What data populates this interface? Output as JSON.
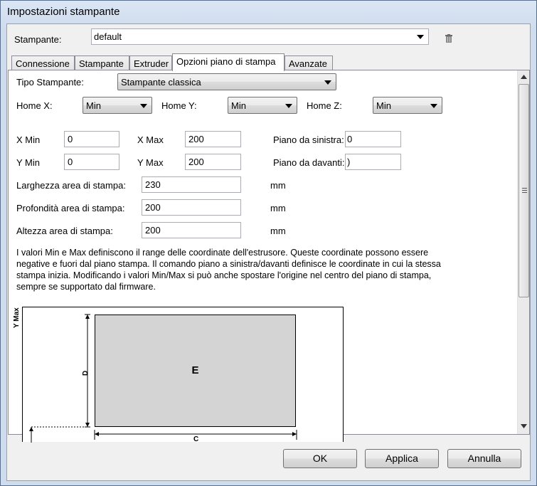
{
  "window": {
    "title": "Impostazioni stampante"
  },
  "printer": {
    "label": "Stampante:",
    "value": "default"
  },
  "tabs": [
    {
      "label": "Connessione"
    },
    {
      "label": "Stampante"
    },
    {
      "label": "Extruder"
    },
    {
      "label": "Opzioni piano di stampa"
    },
    {
      "label": "Avanzate"
    }
  ],
  "form": {
    "tipo_label": "Tipo Stampante:",
    "tipo_value": "Stampante classica",
    "homex_label": "Home X:",
    "homex_value": "Min",
    "homey_label": "Home Y:",
    "homey_value": "Min",
    "homez_label": "Home Z:",
    "homez_value": "Min",
    "xmin_label": "X Min",
    "xmin_value": "0",
    "xmax_label": "X Max",
    "xmax_value": "200",
    "ymin_label": "Y Min",
    "ymin_value": "0",
    "ymax_label": "Y Max",
    "ymax_value": "200",
    "left_label": "Piano da sinistra:",
    "left_value": "0",
    "front_label": "Piano da davanti:",
    "front_value": ")",
    "width_label": "Larghezza area di stampa:",
    "width_value": "230",
    "depth_label": "Profondità area di stampa:",
    "depth_value": "200",
    "height_label": "Altezza area di stampa:",
    "height_value": "200",
    "unit": "mm",
    "description": "I valori Min e Max definiscono il range delle coordinate dell'estrusore. Queste coordinate possono essere negative e fuori dal piano stampa. Il comando piano a sinistra/davanti definisce le coordinate in cui la stessa stampa inizia. Modificando i valori Min/Max si può anche spostare l'origine nel centro del piano di stampa, sempre se supportato dal firmware."
  },
  "diagram": {
    "ymax_label": "Y Max",
    "bed_label": "E",
    "d_label": "D",
    "c_label": "C"
  },
  "buttons": {
    "ok": "OK",
    "apply": "Applica",
    "cancel": "Annulla"
  },
  "icons": {
    "trash": "trash-icon",
    "dropdown": "chevron-down-icon"
  }
}
